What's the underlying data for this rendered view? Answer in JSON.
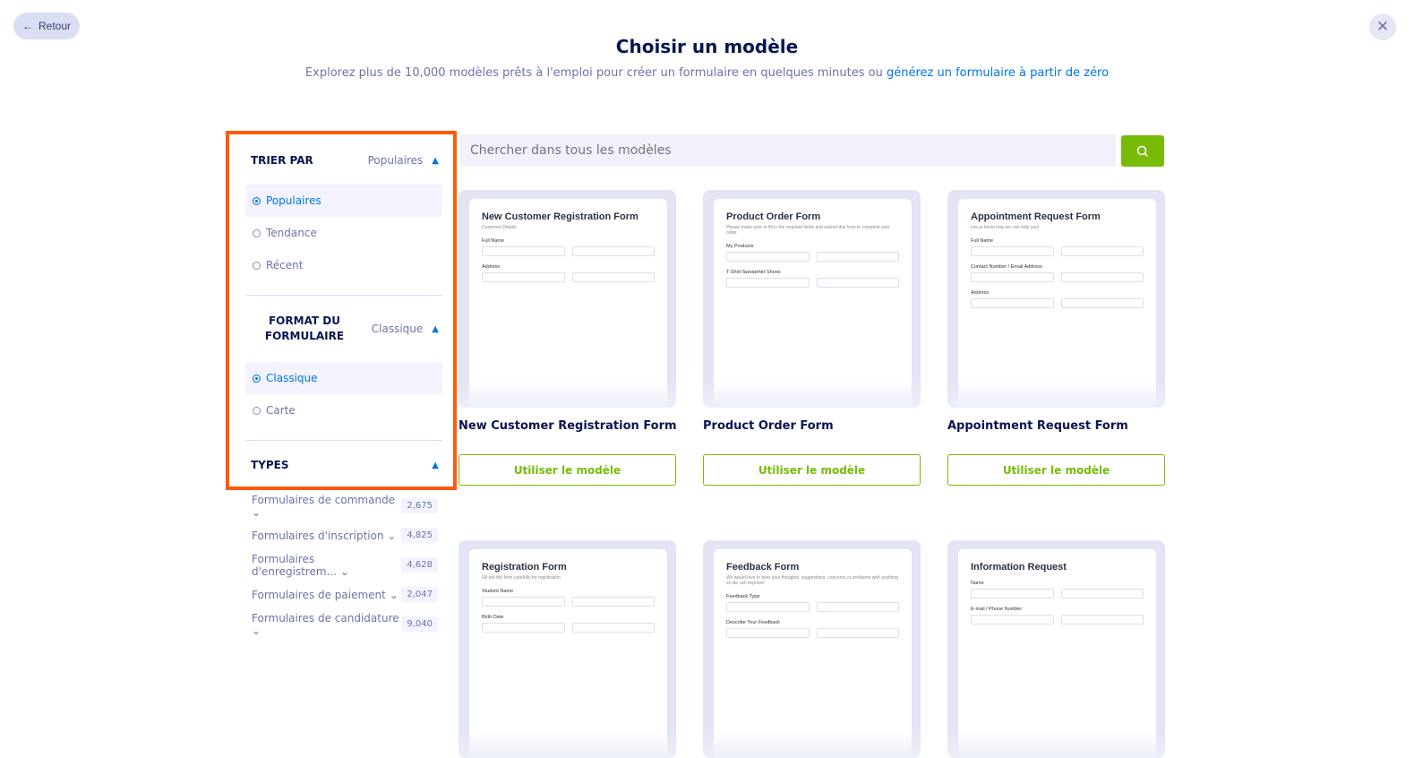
{
  "header": {
    "back_label": "Retour",
    "title": "Choisir un modèle",
    "subtitle": "Explorez plus de 10,000 modèles prêts à l'emploi pour créer un formulaire en quelques minutes ou ",
    "subtitle_link": "générez un formulaire à partir de zéro"
  },
  "sidebar": {
    "sort": {
      "heading": "TRIER PAR",
      "selected": "Populaires",
      "options": [
        "Populaires",
        "Tendance",
        "Récent"
      ]
    },
    "format": {
      "heading": "FORMAT DU FORMULAIRE",
      "selected": "Classique",
      "options": [
        "Classique",
        "Carte"
      ]
    },
    "types": {
      "heading": "TYPES",
      "items": [
        {
          "label": "Formulaires de commande",
          "count": "2,675"
        },
        {
          "label": "Formulaires d'inscription",
          "count": "4,825"
        },
        {
          "label": "Formulaires d'enregistrem...",
          "count": "4,628"
        },
        {
          "label": "Formulaires de paiement",
          "count": "2,047"
        },
        {
          "label": "Formulaires de candidature",
          "count": "9,040"
        }
      ]
    }
  },
  "search": {
    "placeholder": "Chercher dans tous les modèles"
  },
  "use_label": "Utiliser le modèle",
  "accent": "#78bb07",
  "templates": [
    {
      "title": "New Customer Registration Form",
      "preview_title": "New Customer Registration Form",
      "preview_desc": "Customer Details:",
      "fields": [
        "Full Name",
        "Address"
      ]
    },
    {
      "title": "Product Order Form",
      "preview_title": "Product Order Form",
      "preview_desc": "Please make sure to fill in the required fields and submit this form to complete your order.",
      "fields": [
        "My Products",
        "T-Shirt  Sweatshirt  Shoes"
      ]
    },
    {
      "title": "Appointment Request Form",
      "preview_title": "Appointment Request Form",
      "preview_desc": "Let us know how we can help you!",
      "fields": [
        "Full Name",
        "Contact Number / Email Address",
        "Address"
      ]
    },
    {
      "title": "",
      "preview_title": "Registration Form",
      "preview_desc": "Fill out the form carefully for registration",
      "fields": [
        "Student Name",
        "Birth Date"
      ]
    },
    {
      "title": "",
      "preview_title": "Feedback Form",
      "preview_desc": "We would love to hear your thoughts, suggestions, concerns or problems with anything so we can improve!",
      "fields": [
        "Feedback Type",
        "Describe Your Feedback"
      ]
    },
    {
      "title": "",
      "preview_title": "Information Request",
      "preview_desc": "",
      "fields": [
        "Name",
        "E-mail / Phone Number"
      ]
    }
  ]
}
